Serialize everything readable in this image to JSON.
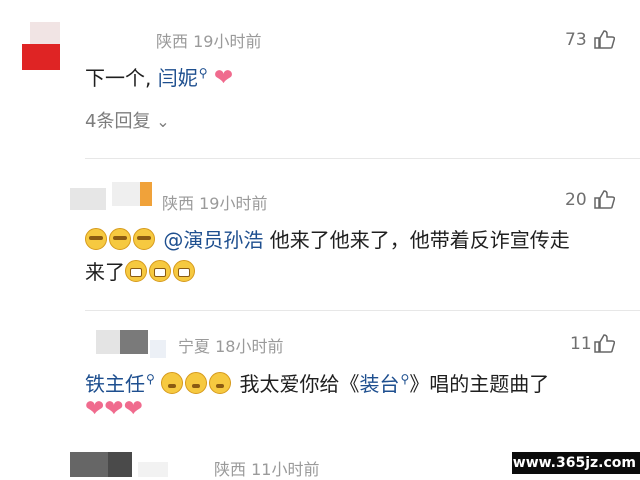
{
  "comments": [
    {
      "location": "陕西",
      "time": "19小时前",
      "likes": "73",
      "text_prefix": "下一个,",
      "mention": "闫妮",
      "replies_label": "4条回复"
    },
    {
      "location": "陕西",
      "time": "19小时前",
      "likes": "20",
      "mention": "@演员孙浩",
      "text": "他来了他来了，他带着反诈宣传走",
      "text_line2": "来了"
    },
    {
      "location": "宁夏",
      "time": "18小时前",
      "likes": "11",
      "mention": "铁主任",
      "text_mid": "我太爱你给《",
      "mention_2": "装台",
      "text_end": "》唱的主题曲了"
    },
    {
      "location": "陕西",
      "time": "11小时前"
    }
  ],
  "watermark": "www.365jz.com",
  "icons": {
    "like": "thumbs-up-icon",
    "search": "magnifier-icon",
    "heart": "heart-emoji",
    "chevron": "chevron-down-icon"
  }
}
